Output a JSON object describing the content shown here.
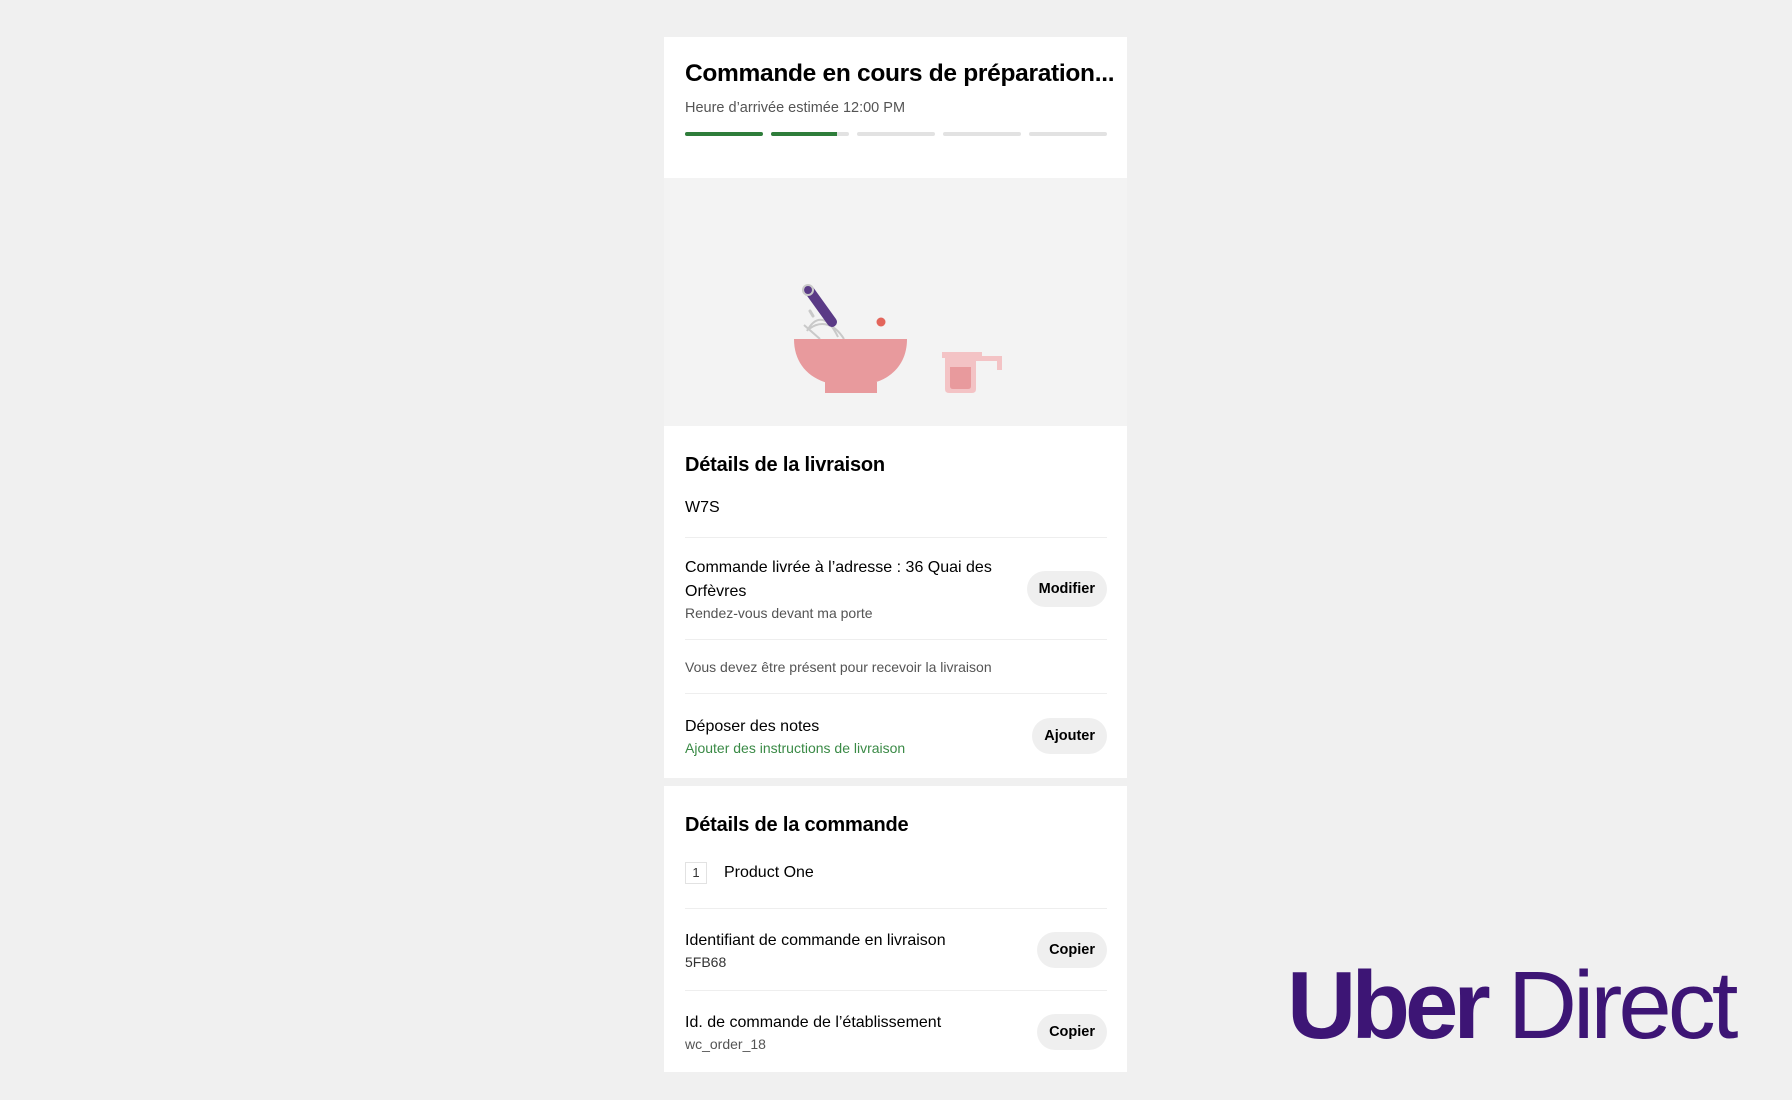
{
  "order_status": {
    "title": "Commande en cours de préparation...",
    "eta": "Heure d’arrivée estimée 12:00 PM",
    "progress": [
      1.0,
      0.84,
      0,
      0,
      0
    ],
    "progress_color": "#2e7d3a"
  },
  "delivery": {
    "title": "Détails de la livraison",
    "code": "W7S",
    "address_label": "Commande livrée à l’adresse : 36 Quai des Orfèvres",
    "address_note": "Rendez-vous devant ma porte",
    "modify_button": "Modifier",
    "presence_note": "Vous devez être présent pour recevoir la livraison",
    "notes_label": "Déposer des notes",
    "notes_link": "Ajouter des instructions de livraison",
    "add_button": "Ajouter"
  },
  "order": {
    "title": "Détails de la commande",
    "items": [
      {
        "qty": "1",
        "name": "Product One"
      }
    ],
    "delivery_id_label": "Identifiant de commande en livraison",
    "delivery_id_value": "5FB68",
    "store_id_label": "Id. de commande de l’établissement",
    "store_id_value": "wc_order_18",
    "copy_button": "Copier"
  },
  "brand": {
    "part1": "Uber",
    "part2": "Direct",
    "color": "#3d1575"
  },
  "icons": [
    "mixing-bowl-icon",
    "whisk-icon",
    "measuring-cup-icon"
  ]
}
